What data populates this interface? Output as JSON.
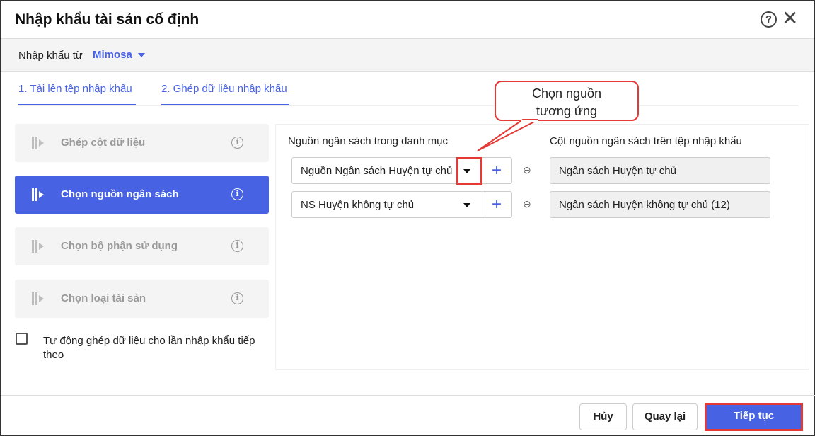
{
  "header": {
    "title": "Nhập khẩu tài sản cố định",
    "help": "?",
    "close": "✕"
  },
  "source": {
    "label": "Nhập khẩu từ",
    "value": "Mimosa"
  },
  "tabs": [
    {
      "label": "1. Tải lên tệp nhập khẩu"
    },
    {
      "label": "2. Ghép dữ liệu nhập khẩu"
    }
  ],
  "steps": [
    {
      "label": "Ghép cột dữ liệu"
    },
    {
      "label": "Chọn nguồn ngân sách"
    },
    {
      "label": "Chọn bộ phận sử dụng"
    },
    {
      "label": "Chọn loại tài sản"
    }
  ],
  "auto_map": {
    "label": "Tự động ghép dữ liệu cho lần nhập khẩu tiếp theo",
    "checked": false
  },
  "columns": {
    "left": "Nguồn ngân sách trong danh mục",
    "right": "Cột nguồn ngân sách trên tệp nhập khẩu"
  },
  "rows": [
    {
      "selected": "Nguồn Ngân sách Huyện tự chủ",
      "file": "Ngân sách Huyện tự chủ"
    },
    {
      "selected": "NS Huyện không tự chủ",
      "file": "Ngân sách Huyện  không tự chủ (12)"
    }
  ],
  "callout": {
    "line1": "Chọn nguồn",
    "line2": "tương ứng"
  },
  "footer": {
    "cancel": "Hủy",
    "back": "Quay lại",
    "next": "Tiếp tục"
  },
  "colors": {
    "accent": "#4763e4",
    "highlight": "#e53935"
  }
}
